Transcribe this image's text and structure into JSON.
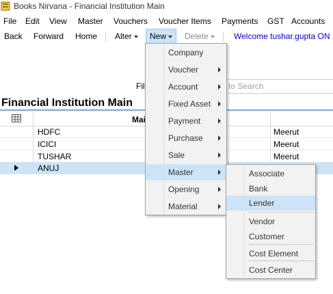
{
  "window": {
    "title": "Books Nirvana - Financial Institution Main"
  },
  "menubar": [
    "File",
    "Edit",
    "View",
    "Master",
    "Vouchers",
    "Voucher Items",
    "Payments",
    "GST",
    "Accounts"
  ],
  "toolbar": {
    "back": "Back",
    "forward": "Forward",
    "home": "Home",
    "alter": "Alter",
    "new": "New",
    "delete": "Delete",
    "welcome": "Welcome tushar.gupta ON I"
  },
  "filter": {
    "label": "Fil",
    "search_placeholder": "to Search"
  },
  "page": {
    "heading": "Financial Institution Main"
  },
  "grid": {
    "header_main": "Mai",
    "rows": [
      {
        "name": "HDFC",
        "city": "Meerut"
      },
      {
        "name": "ICICI",
        "city": "Meerut"
      },
      {
        "name": "TUSHAR",
        "city": "Meerut"
      },
      {
        "name": "ANUJ",
        "city": ""
      }
    ]
  },
  "new_menu": [
    "Company",
    "Voucher",
    "Account",
    "Fixed Asset",
    "Payment",
    "Purchase",
    "Sale",
    "Master",
    "Opening",
    "Material"
  ],
  "master_submenu": [
    "Associate",
    "Bank",
    "Lender",
    "Vendor",
    "Customer",
    "Cost Element",
    "Cost Center"
  ]
}
